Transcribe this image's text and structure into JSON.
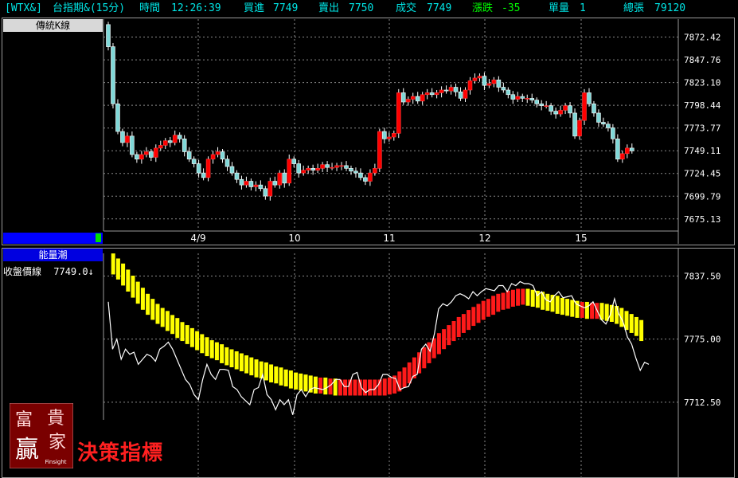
{
  "quote_bar": {
    "symbol": "[WTX&]",
    "name": "台指期&(15分)",
    "time_label": "時間",
    "time": "12:26:39",
    "bid_label": "買進",
    "bid": "7749",
    "ask_label": "賣出",
    "ask": "7750",
    "last_label": "成交",
    "last": "7749",
    "change_label": "漲跌",
    "change": "-35",
    "vol_label": "單量",
    "vol": "1",
    "total_label": "總張",
    "total": "79120"
  },
  "top_panel": {
    "title": "傳統K線",
    "y_ticks": [
      "7872.42",
      "7847.76",
      "7823.10",
      "7798.44",
      "7773.77",
      "7749.11",
      "7724.45",
      "7699.79",
      "7675.13"
    ],
    "x_ticks": [
      "4/9",
      "10",
      "11",
      "12",
      "15"
    ]
  },
  "bottom_panel": {
    "title": "能量潮",
    "close_line_label": "收盤價線",
    "close_line_value": "7749.0↓",
    "y_ticks": [
      "7837.50",
      "7775.00",
      "7712.50"
    ]
  },
  "brand": {
    "logo_text": [
      "富",
      "貴",
      "贏",
      "家"
    ],
    "logo_sub": "Finsight",
    "slogan": "決策指標"
  },
  "colors": {
    "up": "#ff0000",
    "down": "#7fd8d8",
    "energy_up": "#ff1a1a",
    "energy_down": "#ffff00",
    "grid": "#8a8a8a"
  },
  "chart_data": [
    {
      "type": "candlestick",
      "title": "傳統K線",
      "categories": [
        "4/9",
        "10",
        "11",
        "12",
        "15"
      ],
      "ylim": [
        7662,
        7885
      ],
      "y_ticks": [
        7872.42,
        7847.76,
        7823.1,
        7798.44,
        7773.77,
        7749.11,
        7724.45,
        7699.79,
        7675.13
      ],
      "closes": [
        7862,
        7800,
        7770,
        7758,
        7765,
        7745,
        7740,
        7745,
        7748,
        7742,
        7752,
        7755,
        7760,
        7758,
        7766,
        7762,
        7748,
        7740,
        7735,
        7725,
        7720,
        7740,
        7745,
        7748,
        7740,
        7732,
        7725,
        7718,
        7712,
        7716,
        7710,
        7712,
        7708,
        7700,
        7716,
        7712,
        7725,
        7714,
        7740,
        7735,
        7725,
        7728,
        7730,
        7728,
        7730,
        7734,
        7731,
        7731,
        7733,
        7733,
        7730,
        7727,
        7725,
        7720,
        7716,
        7725,
        7730,
        7770,
        7762,
        7764,
        7768,
        7812,
        7802,
        7805,
        7808,
        7803,
        7810,
        7812,
        7810,
        7812,
        7815,
        7814,
        7818,
        7813,
        7806,
        7815,
        7825,
        7828,
        7830,
        7820,
        7822,
        7826,
        7818,
        7815,
        7810,
        7805,
        7808,
        7806,
        7806,
        7804,
        7800,
        7798,
        7798,
        7792,
        7789,
        7793,
        7798,
        7790,
        7765,
        7782,
        7812,
        7800,
        7790,
        7780,
        7778,
        7774,
        7762,
        7740,
        7746,
        7752,
        7749
      ]
    },
    {
      "type": "line",
      "title": "能量潮",
      "ylim": [
        7695,
        7860
      ],
      "y_ticks": [
        7837.5,
        7775.0,
        7712.5
      ],
      "series": [
        {
          "name": "收盤價線",
          "values": [
            7812,
            7765,
            7775,
            7755,
            7765,
            7760,
            7762,
            7750,
            7755,
            7760,
            7758,
            7753,
            7765,
            7768,
            7772,
            7765,
            7755,
            7745,
            7735,
            7730,
            7720,
            7715,
            7735,
            7750,
            7740,
            7735,
            7745,
            7745,
            7744,
            7728,
            7725,
            7718,
            7714,
            7710,
            7725,
            7727,
            7740,
            7720,
            7715,
            7705,
            7715,
            7710,
            7715,
            7700,
            7720,
            7725,
            7718,
            7725,
            7727,
            7726,
            7725,
            7727,
            7730,
            7735,
            7735,
            7728,
            7728,
            7740,
            7742,
            7727,
            7722,
            7725,
            7725,
            7730,
            7740,
            7740,
            7737,
            7736,
            7725,
            7727,
            7728,
            7738,
            7740,
            7765,
            7770,
            7763,
            7780,
            7805,
            7810,
            7808,
            7812,
            7818,
            7820,
            7818,
            7815,
            7822,
            7818,
            7822,
            7825,
            7824,
            7823,
            7828,
            7828,
            7822,
            7830,
            7828,
            7832,
            7830,
            7830,
            7828,
            7818,
            7822,
            7814,
            7812,
            7818,
            7822,
            7816,
            7817,
            7818,
            7810,
            7808,
            7806,
            7808,
            7812,
            7803,
            7794,
            7790,
            7799,
            7815,
            7800,
            7792,
            7777,
            7770,
            7756,
            7744,
            7752,
            7750
          ]
        }
      ],
      "energy_bars": [
        7852,
        7847,
        7842,
        7836,
        7830,
        7824,
        7818,
        7812,
        7807,
        7802,
        7798,
        7795,
        7791,
        7788,
        7784,
        7781,
        7778,
        7775,
        7772,
        7769,
        7766,
        7764,
        7762,
        7759,
        7757,
        7755,
        7753,
        7751,
        7749,
        7747,
        7745,
        7744,
        7742,
        7740,
        7739,
        7737,
        7736,
        7734,
        7733,
        7732,
        7731,
        7730,
        7729,
        7729,
        7728,
        7728,
        7727,
        7727,
        7727,
        7727,
        7727,
        7727,
        7727,
        7727,
        7727,
        7727,
        7728,
        7729,
        7731,
        7735,
        7739,
        7744,
        7749,
        7754,
        7759,
        7764,
        7768,
        7773,
        7777,
        7781,
        7785,
        7789,
        7792,
        7796,
        7799,
        7802,
        7805,
        7807,
        7810,
        7812,
        7813,
        7815,
        7816,
        7817,
        7817,
        7816,
        7815,
        7814,
        7812,
        7811,
        7810,
        7808,
        7807,
        7806,
        7805,
        7804,
        7804,
        7803,
        7803,
        7803,
        7802,
        7801,
        7800,
        7798,
        7795,
        7792,
        7789,
        7786,
        7781
      ]
    }
  ]
}
